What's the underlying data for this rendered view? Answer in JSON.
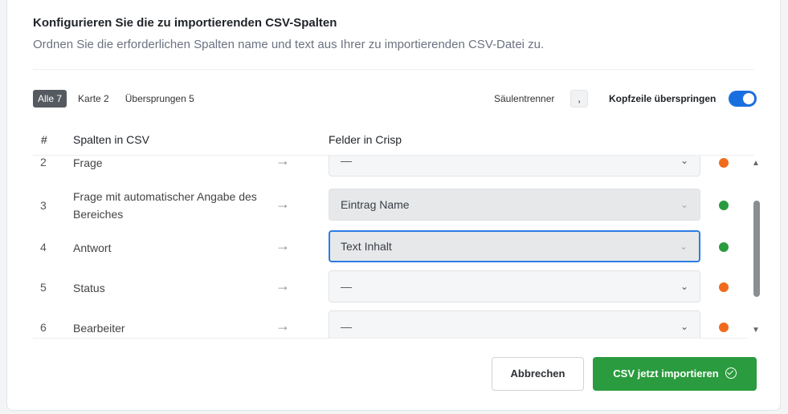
{
  "dialog": {
    "title": "Konfigurieren Sie die zu importierenden CSV-Spalten",
    "subtitle": "Ordnen Sie die erforderlichen Spalten name und text aus Ihrer zu importierenden CSV-Datei zu."
  },
  "filters": [
    {
      "label": "Alle 7",
      "active": true
    },
    {
      "label": "Karte 2",
      "active": false
    },
    {
      "label": "Übersprungen 5",
      "active": false
    }
  ],
  "options": {
    "separator_label": "Säulentrenner",
    "separator_value": ",",
    "skip_header_label": "Kopfzeile überspringen",
    "skip_header_on": true
  },
  "table": {
    "headers": {
      "num": "#",
      "csv": "Spalten in CSV",
      "crisp": "Felder in Crisp"
    },
    "rows": [
      {
        "num": "2",
        "csv": "Frage",
        "field": "—",
        "status": "orange"
      },
      {
        "num": "3",
        "csv": "Frage mit automatischer Angabe des Bereiches",
        "field": "Eintrag Name",
        "status": "green"
      },
      {
        "num": "4",
        "csv": "Antwort",
        "field": "Text Inhalt",
        "status": "green"
      },
      {
        "num": "5",
        "csv": "Status",
        "field": "—",
        "status": "orange"
      },
      {
        "num": "6",
        "csv": "Bearbeiter",
        "field": "—",
        "status": "orange"
      }
    ]
  },
  "buttons": {
    "cancel": "Abbrechen",
    "import": "CSV jetzt importieren"
  },
  "colors": {
    "accent": "#1a6fe0",
    "success": "#2a9b3e",
    "warning": "#f26b1d"
  },
  "icons": {
    "arrow": "arrow-right-icon",
    "chevron": "chevron-down-icon",
    "check": "check-circle-icon"
  }
}
